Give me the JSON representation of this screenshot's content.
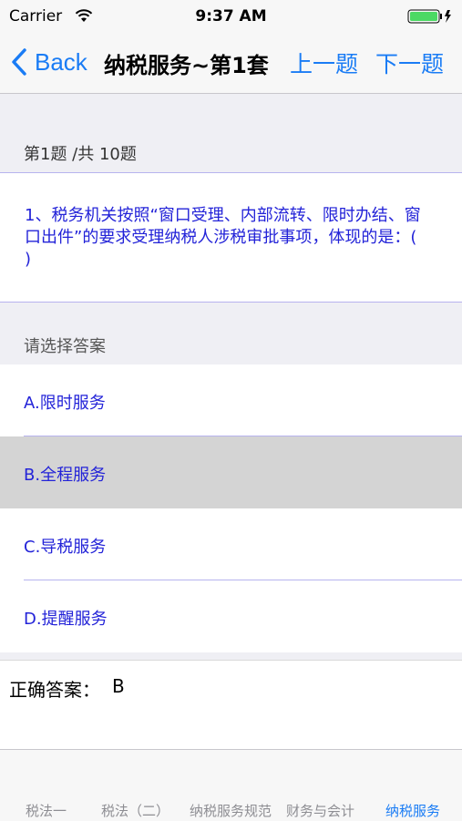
{
  "status_bar": {
    "carrier": "Carrier",
    "time": "9:37 AM"
  },
  "nav": {
    "back_label": "Back",
    "title": "纳税服务~第1套",
    "prev_label": "上一题",
    "next_label": "下一题"
  },
  "question": {
    "progress": "第1题 /共 10题",
    "text": "1、税务机关按照“窗口受理、内部流转、限时办结、窗口出件”的要求受理纳税人涉税审批事项，体现的是：(　 )"
  },
  "answers": {
    "header": "请选择答案",
    "options": [
      {
        "label": "A.限时服务"
      },
      {
        "label": "B.全程服务"
      },
      {
        "label": "C.导税服务"
      },
      {
        "label": "D.提醒服务"
      }
    ],
    "selected_index": 1
  },
  "result": {
    "label": "正确答案：",
    "value": "B"
  },
  "tabs": [
    {
      "label": "税法一"
    },
    {
      "label": "税法（二）"
    },
    {
      "label": "纳税服务规范"
    },
    {
      "label": "财务与会计"
    },
    {
      "label": "纳税服务"
    }
  ],
  "active_tab_index": 4,
  "colors": {
    "accent": "#1a7cf5",
    "question_text": "#2323d8",
    "battery": "#4cd964"
  },
  "icons": {
    "wifi": "wifi-icon",
    "battery": "battery-icon",
    "back": "chevron-left-icon"
  }
}
